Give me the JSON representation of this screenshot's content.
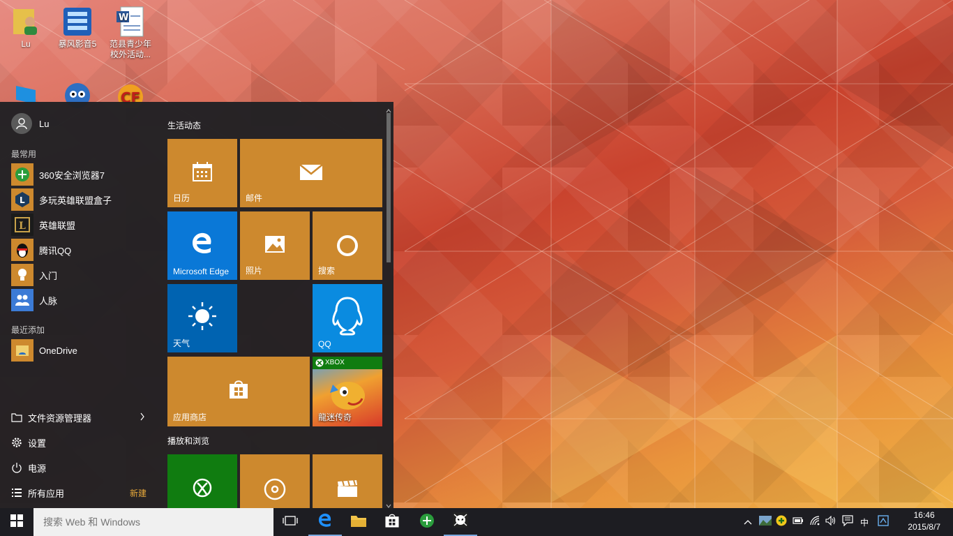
{
  "desktop": {
    "icons": [
      {
        "label": "Lu",
        "icon": "user-folder-icon"
      },
      {
        "label": "暴风影音5",
        "icon": "media-player-icon"
      },
      {
        "label": "范县青少年校外活动...",
        "icon": "word-document-icon"
      },
      {
        "label": "",
        "icon": "computer-icon"
      },
      {
        "label": "",
        "icon": "game-character-icon"
      },
      {
        "label": "",
        "icon": "crossfire-icon"
      }
    ]
  },
  "start_menu": {
    "user": {
      "name": "Lu"
    },
    "most_used_label": "最常用",
    "most_used": [
      {
        "label": "360安全浏览器7",
        "color": "#2a9d3c"
      },
      {
        "label": "多玩英雄联盟盒子",
        "color": "#1a3a5c"
      },
      {
        "label": "英雄联盟",
        "color": "#1b1b1b"
      },
      {
        "label": "腾讯QQ",
        "color": "#cd892e"
      },
      {
        "label": "入门",
        "color": "#cd892e"
      },
      {
        "label": "人脉",
        "color": "#3c7bd6"
      }
    ],
    "recent_label": "最近添加",
    "recent": [
      {
        "label": "OneDrive",
        "color": "#cd892e"
      }
    ],
    "bottom": {
      "file_explorer": "文件资源管理器",
      "settings": "设置",
      "power": "电源",
      "all_apps": "所有应用",
      "new_badge": "新建"
    },
    "groups": {
      "life": "生活动态",
      "play": "播放和浏览"
    },
    "tiles": {
      "calendar": "日历",
      "mail": "邮件",
      "edge": "Microsoft Edge",
      "photos": "照片",
      "search": "搜索",
      "weather": "天气",
      "qq": "QQ",
      "store": "应用商店",
      "game_brand": "XBOX",
      "game": "龍迷传奇"
    }
  },
  "taskbar": {
    "search_placeholder": "搜索 Web 和 Windows",
    "ime": "中",
    "time": "16:46",
    "date": "2015/8/7"
  },
  "colors": {
    "tile_orange": "#cd892e",
    "edge_blue": "#0a78d7",
    "weather_blue": "#0063b1",
    "qq_blue": "#0a8be0",
    "xbox_green": "#107c10",
    "new_badge": "#e8a93a"
  }
}
